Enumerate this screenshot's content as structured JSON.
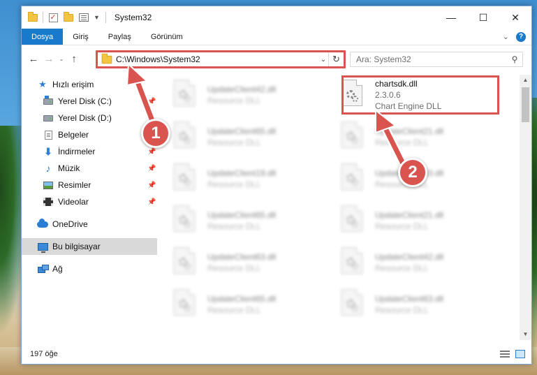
{
  "window": {
    "title": "System32",
    "controls": {
      "minimize": "—",
      "maximize": "☐",
      "close": "✕"
    }
  },
  "ribbon": {
    "tabs": [
      {
        "label": "Dosya",
        "active": true
      },
      {
        "label": "Giriş"
      },
      {
        "label": "Paylaş"
      },
      {
        "label": "Görünüm"
      }
    ],
    "help": "?"
  },
  "addressbar": {
    "path": "C:\\Windows\\System32",
    "refresh": "↻"
  },
  "search": {
    "placeholder": "Ara: System32"
  },
  "sidebar": {
    "items": [
      {
        "label": "Hızlı erişim",
        "icon": "star-icon"
      },
      {
        "label": "Yerel Disk (C:)",
        "icon": "drive-c-icon"
      },
      {
        "label": "Yerel Disk (D:)",
        "icon": "drive-d-icon"
      },
      {
        "label": "Belgeler",
        "icon": "documents-icon"
      },
      {
        "label": "İndirmeler",
        "icon": "downloads-icon"
      },
      {
        "label": "Müzik",
        "icon": "music-icon"
      },
      {
        "label": "Resimler",
        "icon": "pictures-icon"
      },
      {
        "label": "Videolar",
        "icon": "videos-icon"
      },
      {
        "label": "OneDrive",
        "icon": "cloud-icon"
      },
      {
        "label": "Bu bilgisayar",
        "icon": "pc-icon",
        "selected": true
      },
      {
        "label": "Ağ",
        "icon": "network-icon"
      }
    ]
  },
  "files": {
    "highlighted": {
      "name": "chartsdk.dll",
      "version": "2.3.0.6",
      "description": "Chart Engine DLL"
    },
    "blurred": [
      {
        "name": "UpdateClient42.dll",
        "type": "Resource DLL"
      },
      {
        "name": "UpdateClient65.dll",
        "type": "Resource DLL"
      },
      {
        "name": "UpdateClient21.dll",
        "type": "Resource DLL"
      },
      {
        "name": "UpdateClient19.dll",
        "type": "Resource DLL"
      },
      {
        "name": "UpdateClient63.dll",
        "type": "Resource DLL"
      },
      {
        "name": "UpdateClient65.dll",
        "type": "Resource DLL"
      },
      {
        "name": "UpdateClient21.dll",
        "type": "Resource DLL"
      },
      {
        "name": "UpdateClient63.dll",
        "type": "Resource DLL"
      },
      {
        "name": "UpdateClient42.dll",
        "type": "Resource DLL"
      },
      {
        "name": "UpdateClient65.dll",
        "type": "Resource DLL"
      },
      {
        "name": "UpdateClient63.dll",
        "type": "Resource DLL"
      }
    ]
  },
  "status": {
    "count": "197 öğe"
  },
  "annotations": {
    "step1": "1",
    "step2": "2",
    "color": "#d9534f"
  }
}
